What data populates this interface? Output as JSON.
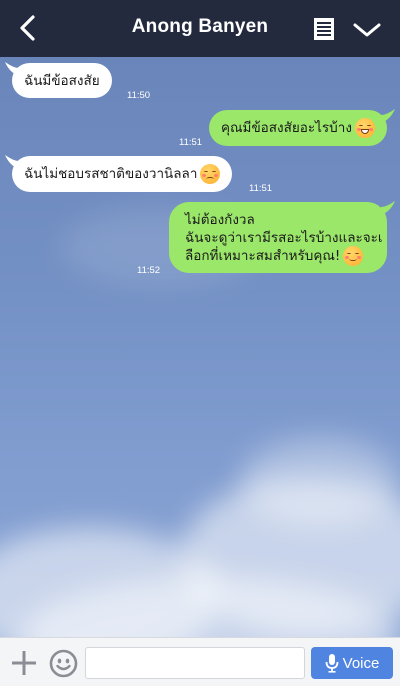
{
  "header": {
    "title": "Anong Banyen",
    "back_icon": "chevron-left-icon",
    "notes_icon": "notes-icon",
    "menu_icon": "chevron-down-icon",
    "background_color": "#232a3e"
  },
  "messages": [
    {
      "direction": "incoming",
      "text": "ฉันมีข้อสงสัย",
      "time": "11:50"
    },
    {
      "direction": "outgoing",
      "text": "คุณมีข้อสงสัยอะไรบ้าง",
      "emoji": "grinning-face-icon",
      "time": "11:51"
    },
    {
      "direction": "incoming",
      "text": "ฉันไม่ชอบรสชาติของวานิลลา",
      "emoji": "sad-face-icon",
      "time": "11:51"
    },
    {
      "direction": "outgoing",
      "lines": [
        "ไม่ต้องกังวล",
        "ฉันจะดูว่าเรามีรสอะไรบ้างและจะเ",
        "ลือกที่เหมาะสมสำหรับคุณ!"
      ],
      "emoji": "smiling-face-icon",
      "time": "11:52"
    }
  ],
  "composer": {
    "plus_icon": "plus-icon",
    "emoji_icon": "emoji-icon",
    "input_value": "",
    "input_placeholder": "",
    "voice_label": "Voice",
    "voice_icon": "microphone-icon"
  },
  "colors": {
    "incoming_bubble": "#ffffff",
    "outgoing_bubble": "#9be76a",
    "voice_button": "#4f84e0"
  }
}
